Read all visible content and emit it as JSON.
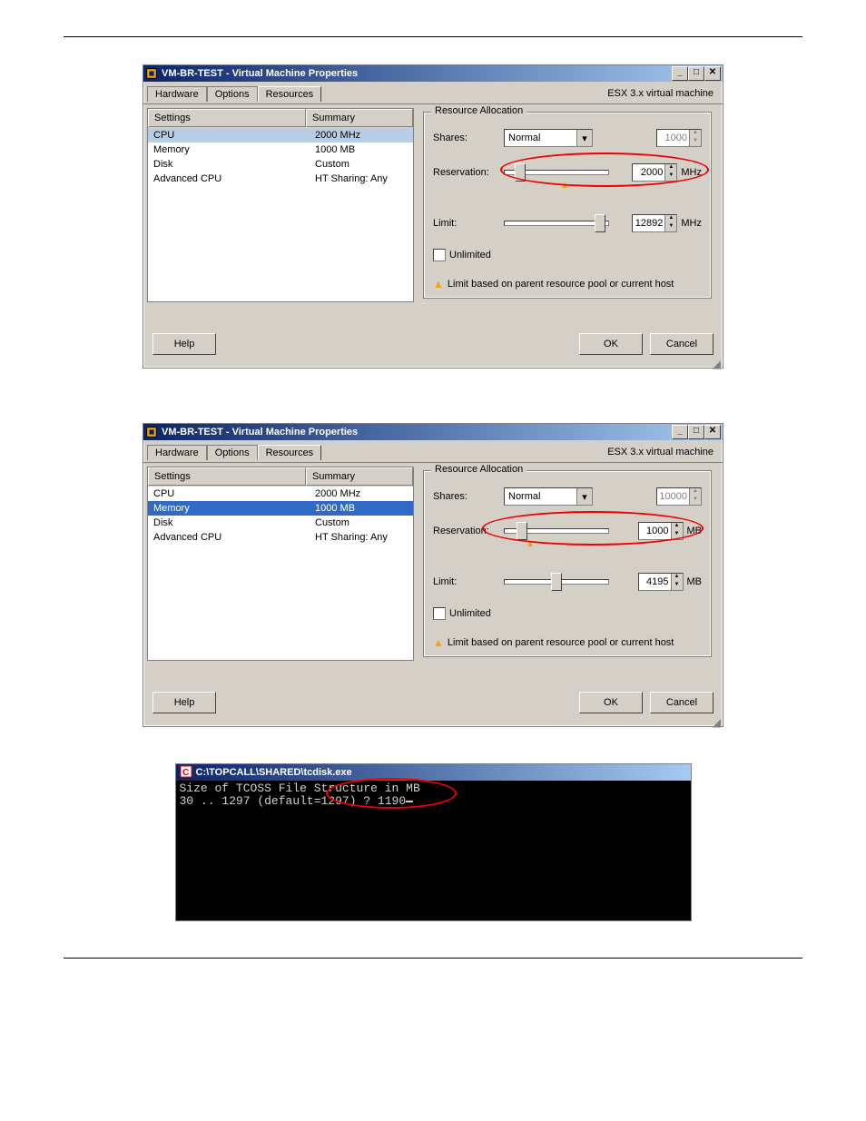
{
  "dialog1": {
    "title": "VM-BR-TEST - Virtual Machine Properties",
    "esx": "ESX 3.x virtual machine",
    "tabs": [
      "Hardware",
      "Options",
      "Resources"
    ],
    "active_tab": 2,
    "header": {
      "settings": "Settings",
      "summary": "Summary"
    },
    "rows": [
      {
        "name": "CPU",
        "summary": "2000 MHz",
        "selected": true
      },
      {
        "name": "Memory",
        "summary": "1000 MB"
      },
      {
        "name": "Disk",
        "summary": "Custom"
      },
      {
        "name": "Advanced CPU",
        "summary": "HT Sharing: Any"
      }
    ],
    "group": "Resource Allocation",
    "shares_label": "Shares:",
    "shares_value": "Normal",
    "shares_num": "1000",
    "reservation_label": "Reservation:",
    "reservation_value": "2000",
    "reservation_unit": "MHz",
    "limit_label": "Limit:",
    "limit_value": "12892",
    "limit_unit": "MHz",
    "unlimited": "Unlimited",
    "warn": "Limit based on parent resource pool or current host",
    "help": "Help",
    "ok": "OK",
    "cancel": "Cancel"
  },
  "dialog2": {
    "title": "VM-BR-TEST - Virtual Machine Properties",
    "esx": "ESX 3.x virtual machine",
    "tabs": [
      "Hardware",
      "Options",
      "Resources"
    ],
    "active_tab": 2,
    "header": {
      "settings": "Settings",
      "summary": "Summary"
    },
    "rows": [
      {
        "name": "CPU",
        "summary": "2000 MHz"
      },
      {
        "name": "Memory",
        "summary": "1000 MB",
        "selected": true
      },
      {
        "name": "Disk",
        "summary": "Custom"
      },
      {
        "name": "Advanced CPU",
        "summary": "HT Sharing: Any"
      }
    ],
    "group": "Resource Allocation",
    "shares_label": "Shares:",
    "shares_value": "Normal",
    "shares_num": "10000",
    "reservation_label": "Reservation:",
    "reservation_value": "1000",
    "reservation_unit": "MB",
    "limit_label": "Limit:",
    "limit_value": "4195",
    "limit_unit": "MB",
    "unlimited": "Unlimited",
    "warn": "Limit based on parent resource pool or current host",
    "help": "Help",
    "ok": "OK",
    "cancel": "Cancel"
  },
  "console": {
    "title": "C:\\TOPCALL\\SHARED\\tcdisk.exe",
    "line1": "Size of TCOSS File Structure in MB",
    "line2": "30 .. 1297 (default=1297) ? 1190"
  }
}
